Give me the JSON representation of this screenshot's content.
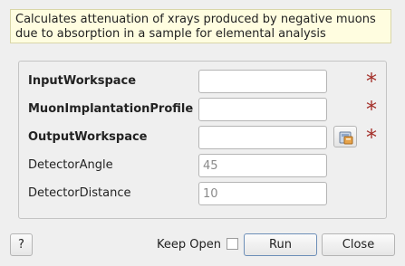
{
  "description": "Calculates attenuation of xrays produced by negative muons due to absorption in a sample for elemental analysis",
  "properties": [
    {
      "label": "InputWorkspace",
      "value": "",
      "placeholder": "",
      "required": true
    },
    {
      "label": "MuonImplantationProfile",
      "value": "",
      "placeholder": "",
      "required": true
    },
    {
      "label": "OutputWorkspace",
      "value": "",
      "placeholder": "",
      "required": true
    },
    {
      "label": "DetectorAngle",
      "value": "",
      "placeholder": "45",
      "required": false
    },
    {
      "label": "DetectorDistance",
      "value": "",
      "placeholder": "10",
      "required": false
    }
  ],
  "required_marker": "*",
  "icons": {
    "required": "asterisk-icon",
    "browse": "workspace-browse-icon"
  },
  "colors": {
    "required_marker": "#a4302a",
    "description_bg": "#fffde0"
  },
  "buttons": {
    "help": "?",
    "keep_open": "Keep Open",
    "keep_open_checked": false,
    "run": "Run",
    "close": "Close"
  }
}
